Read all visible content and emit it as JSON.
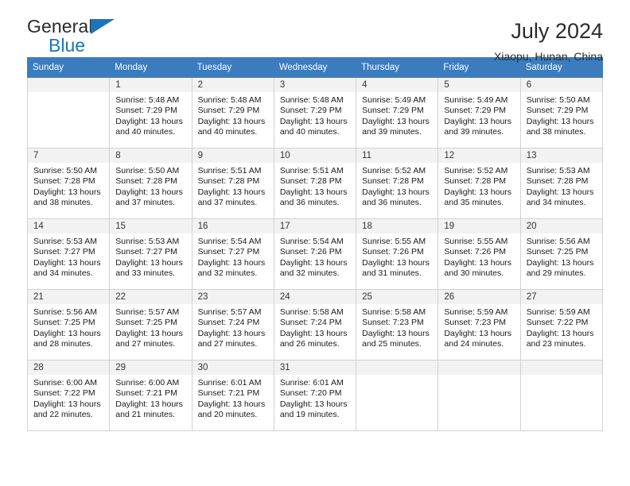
{
  "brand": {
    "name_top": "General",
    "name_bottom": "Blue",
    "accent_color": "#1b75bb"
  },
  "header": {
    "title": "July 2024",
    "subtitle": "Xiaopu, Hunan, China"
  },
  "calendar": {
    "header_bg": "#3a7cbe",
    "weekday_headers": [
      "Sunday",
      "Monday",
      "Tuesday",
      "Wednesday",
      "Thursday",
      "Friday",
      "Saturday"
    ],
    "weeks": [
      [
        {
          "day": "",
          "sunrise": "",
          "sunset": "",
          "daylight_line1": "",
          "daylight_line2": ""
        },
        {
          "day": "1",
          "sunrise": "Sunrise: 5:48 AM",
          "sunset": "Sunset: 7:29 PM",
          "daylight_line1": "Daylight: 13 hours",
          "daylight_line2": "and 40 minutes."
        },
        {
          "day": "2",
          "sunrise": "Sunrise: 5:48 AM",
          "sunset": "Sunset: 7:29 PM",
          "daylight_line1": "Daylight: 13 hours",
          "daylight_line2": "and 40 minutes."
        },
        {
          "day": "3",
          "sunrise": "Sunrise: 5:48 AM",
          "sunset": "Sunset: 7:29 PM",
          "daylight_line1": "Daylight: 13 hours",
          "daylight_line2": "and 40 minutes."
        },
        {
          "day": "4",
          "sunrise": "Sunrise: 5:49 AM",
          "sunset": "Sunset: 7:29 PM",
          "daylight_line1": "Daylight: 13 hours",
          "daylight_line2": "and 39 minutes."
        },
        {
          "day": "5",
          "sunrise": "Sunrise: 5:49 AM",
          "sunset": "Sunset: 7:29 PM",
          "daylight_line1": "Daylight: 13 hours",
          "daylight_line2": "and 39 minutes."
        },
        {
          "day": "6",
          "sunrise": "Sunrise: 5:50 AM",
          "sunset": "Sunset: 7:29 PM",
          "daylight_line1": "Daylight: 13 hours",
          "daylight_line2": "and 38 minutes."
        }
      ],
      [
        {
          "day": "7",
          "sunrise": "Sunrise: 5:50 AM",
          "sunset": "Sunset: 7:28 PM",
          "daylight_line1": "Daylight: 13 hours",
          "daylight_line2": "and 38 minutes."
        },
        {
          "day": "8",
          "sunrise": "Sunrise: 5:50 AM",
          "sunset": "Sunset: 7:28 PM",
          "daylight_line1": "Daylight: 13 hours",
          "daylight_line2": "and 37 minutes."
        },
        {
          "day": "9",
          "sunrise": "Sunrise: 5:51 AM",
          "sunset": "Sunset: 7:28 PM",
          "daylight_line1": "Daylight: 13 hours",
          "daylight_line2": "and 37 minutes."
        },
        {
          "day": "10",
          "sunrise": "Sunrise: 5:51 AM",
          "sunset": "Sunset: 7:28 PM",
          "daylight_line1": "Daylight: 13 hours",
          "daylight_line2": "and 36 minutes."
        },
        {
          "day": "11",
          "sunrise": "Sunrise: 5:52 AM",
          "sunset": "Sunset: 7:28 PM",
          "daylight_line1": "Daylight: 13 hours",
          "daylight_line2": "and 36 minutes."
        },
        {
          "day": "12",
          "sunrise": "Sunrise: 5:52 AM",
          "sunset": "Sunset: 7:28 PM",
          "daylight_line1": "Daylight: 13 hours",
          "daylight_line2": "and 35 minutes."
        },
        {
          "day": "13",
          "sunrise": "Sunrise: 5:53 AM",
          "sunset": "Sunset: 7:28 PM",
          "daylight_line1": "Daylight: 13 hours",
          "daylight_line2": "and 34 minutes."
        }
      ],
      [
        {
          "day": "14",
          "sunrise": "Sunrise: 5:53 AM",
          "sunset": "Sunset: 7:27 PM",
          "daylight_line1": "Daylight: 13 hours",
          "daylight_line2": "and 34 minutes."
        },
        {
          "day": "15",
          "sunrise": "Sunrise: 5:53 AM",
          "sunset": "Sunset: 7:27 PM",
          "daylight_line1": "Daylight: 13 hours",
          "daylight_line2": "and 33 minutes."
        },
        {
          "day": "16",
          "sunrise": "Sunrise: 5:54 AM",
          "sunset": "Sunset: 7:27 PM",
          "daylight_line1": "Daylight: 13 hours",
          "daylight_line2": "and 32 minutes."
        },
        {
          "day": "17",
          "sunrise": "Sunrise: 5:54 AM",
          "sunset": "Sunset: 7:26 PM",
          "daylight_line1": "Daylight: 13 hours",
          "daylight_line2": "and 32 minutes."
        },
        {
          "day": "18",
          "sunrise": "Sunrise: 5:55 AM",
          "sunset": "Sunset: 7:26 PM",
          "daylight_line1": "Daylight: 13 hours",
          "daylight_line2": "and 31 minutes."
        },
        {
          "day": "19",
          "sunrise": "Sunrise: 5:55 AM",
          "sunset": "Sunset: 7:26 PM",
          "daylight_line1": "Daylight: 13 hours",
          "daylight_line2": "and 30 minutes."
        },
        {
          "day": "20",
          "sunrise": "Sunrise: 5:56 AM",
          "sunset": "Sunset: 7:25 PM",
          "daylight_line1": "Daylight: 13 hours",
          "daylight_line2": "and 29 minutes."
        }
      ],
      [
        {
          "day": "21",
          "sunrise": "Sunrise: 5:56 AM",
          "sunset": "Sunset: 7:25 PM",
          "daylight_line1": "Daylight: 13 hours",
          "daylight_line2": "and 28 minutes."
        },
        {
          "day": "22",
          "sunrise": "Sunrise: 5:57 AM",
          "sunset": "Sunset: 7:25 PM",
          "daylight_line1": "Daylight: 13 hours",
          "daylight_line2": "and 27 minutes."
        },
        {
          "day": "23",
          "sunrise": "Sunrise: 5:57 AM",
          "sunset": "Sunset: 7:24 PM",
          "daylight_line1": "Daylight: 13 hours",
          "daylight_line2": "and 27 minutes."
        },
        {
          "day": "24",
          "sunrise": "Sunrise: 5:58 AM",
          "sunset": "Sunset: 7:24 PM",
          "daylight_line1": "Daylight: 13 hours",
          "daylight_line2": "and 26 minutes."
        },
        {
          "day": "25",
          "sunrise": "Sunrise: 5:58 AM",
          "sunset": "Sunset: 7:23 PM",
          "daylight_line1": "Daylight: 13 hours",
          "daylight_line2": "and 25 minutes."
        },
        {
          "day": "26",
          "sunrise": "Sunrise: 5:59 AM",
          "sunset": "Sunset: 7:23 PM",
          "daylight_line1": "Daylight: 13 hours",
          "daylight_line2": "and 24 minutes."
        },
        {
          "day": "27",
          "sunrise": "Sunrise: 5:59 AM",
          "sunset": "Sunset: 7:22 PM",
          "daylight_line1": "Daylight: 13 hours",
          "daylight_line2": "and 23 minutes."
        }
      ],
      [
        {
          "day": "28",
          "sunrise": "Sunrise: 6:00 AM",
          "sunset": "Sunset: 7:22 PM",
          "daylight_line1": "Daylight: 13 hours",
          "daylight_line2": "and 22 minutes."
        },
        {
          "day": "29",
          "sunrise": "Sunrise: 6:00 AM",
          "sunset": "Sunset: 7:21 PM",
          "daylight_line1": "Daylight: 13 hours",
          "daylight_line2": "and 21 minutes."
        },
        {
          "day": "30",
          "sunrise": "Sunrise: 6:01 AM",
          "sunset": "Sunset: 7:21 PM",
          "daylight_line1": "Daylight: 13 hours",
          "daylight_line2": "and 20 minutes."
        },
        {
          "day": "31",
          "sunrise": "Sunrise: 6:01 AM",
          "sunset": "Sunset: 7:20 PM",
          "daylight_line1": "Daylight: 13 hours",
          "daylight_line2": "and 19 minutes."
        },
        {
          "day": "",
          "sunrise": "",
          "sunset": "",
          "daylight_line1": "",
          "daylight_line2": ""
        },
        {
          "day": "",
          "sunrise": "",
          "sunset": "",
          "daylight_line1": "",
          "daylight_line2": ""
        },
        {
          "day": "",
          "sunrise": "",
          "sunset": "",
          "daylight_line1": "",
          "daylight_line2": ""
        }
      ]
    ]
  }
}
